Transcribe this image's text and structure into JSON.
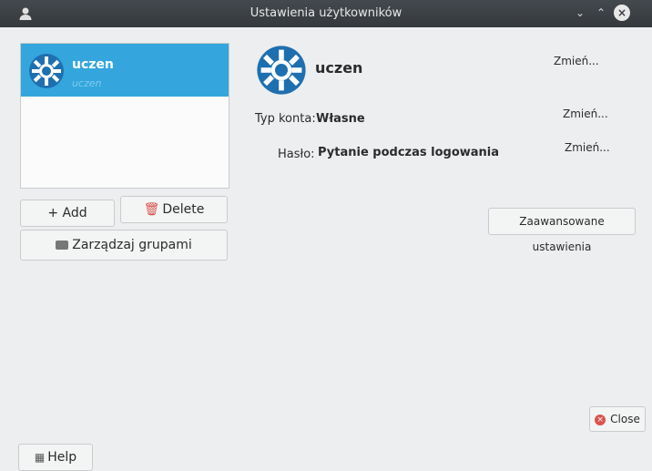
{
  "window": {
    "title": "Ustawienia użytkowników",
    "icons": {
      "app": "user-icon",
      "minimize": "chevron-down-icon",
      "maximize": "chevron-up-icon",
      "close": "close-icon"
    }
  },
  "user_list": {
    "items": [
      {
        "name": "uczen",
        "login": "uczen",
        "selected": true
      }
    ],
    "selected_color": "#34a6dd"
  },
  "buttons": {
    "add": "+ Add",
    "delete": "Delete",
    "manage_groups": "Zarządzaj grupami",
    "advanced": "Zaawansowane ustawienia",
    "close": "Close",
    "help": "Help"
  },
  "details": {
    "name": "uczen",
    "account_type_label": "Typ konta:",
    "account_type_value": "Własne",
    "password_label": "Hasło:",
    "password_value": "Pytanie podczas logowania",
    "change_links": [
      "Zmień...",
      "Zmień...",
      "Zmień..."
    ]
  }
}
